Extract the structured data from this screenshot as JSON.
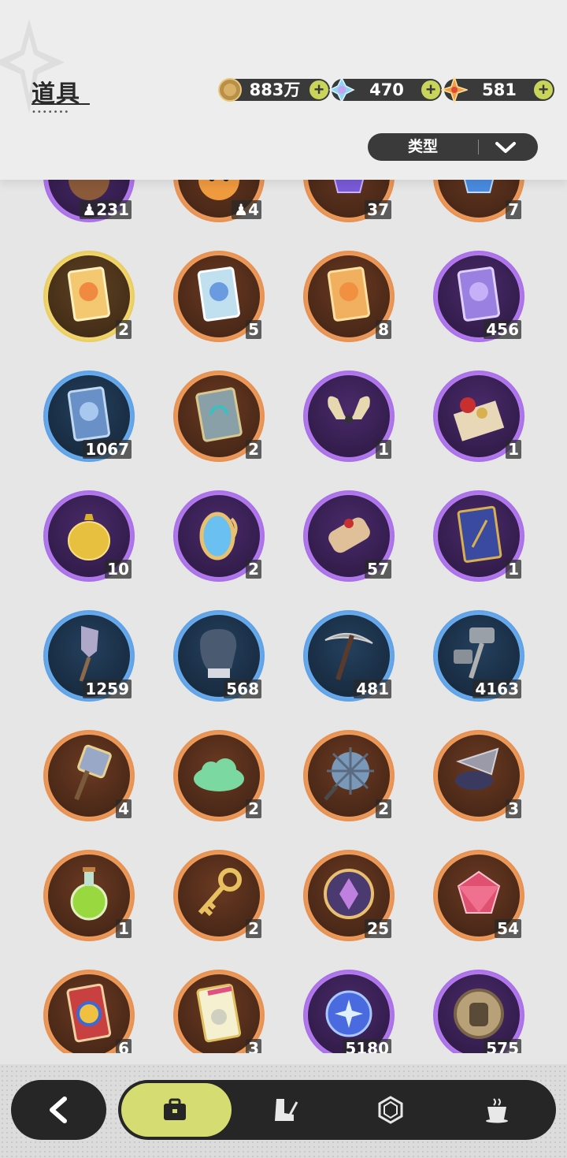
{
  "header": {
    "title": "道具",
    "title_dots": "•••••••",
    "currencies": [
      {
        "name": "gold-coin-icon",
        "value": "883万",
        "plus": "+"
      },
      {
        "name": "crystal-icon",
        "value": "470",
        "plus": "+"
      },
      {
        "name": "star-gem-icon",
        "value": "581",
        "plus": "+"
      }
    ],
    "filter": {
      "label": "类型"
    }
  },
  "items": [
    {
      "icon": "bear-face-icon",
      "rarity": "purple",
      "count": "231",
      "badge": "crowd"
    },
    {
      "icon": "fox-face-icon",
      "rarity": "orange",
      "count": "4",
      "badge": "crowd"
    },
    {
      "icon": "purple-crystal-icon",
      "rarity": "orange",
      "count": "37"
    },
    {
      "icon": "blue-crystal-icon",
      "rarity": "orange",
      "count": "7"
    },
    {
      "icon": "gold-card-icon",
      "rarity": "gold",
      "count": "2"
    },
    {
      "icon": "rainbow-card-icon",
      "rarity": "orange",
      "count": "5"
    },
    {
      "icon": "orange-card-icon",
      "rarity": "orange",
      "count": "8"
    },
    {
      "icon": "purple-card-icon",
      "rarity": "purple",
      "count": "456"
    },
    {
      "icon": "blue-card-icon",
      "rarity": "blue",
      "count": "1067"
    },
    {
      "icon": "book-icon",
      "rarity": "orange",
      "count": "2"
    },
    {
      "icon": "horn-crown-icon",
      "rarity": "purple",
      "count": "1"
    },
    {
      "icon": "gift-box-icon",
      "rarity": "purple",
      "count": "1"
    },
    {
      "icon": "gold-pouch-icon",
      "rarity": "purple",
      "count": "10"
    },
    {
      "icon": "mirror-icon",
      "rarity": "purple",
      "count": "2"
    },
    {
      "icon": "scroll-icon",
      "rarity": "purple",
      "count": "57"
    },
    {
      "icon": "blue-tome-icon",
      "rarity": "purple",
      "count": "1"
    },
    {
      "icon": "shovel-icon",
      "rarity": "blue",
      "count": "1259"
    },
    {
      "icon": "glove-icon",
      "rarity": "blue",
      "count": "568"
    },
    {
      "icon": "pickaxe-icon",
      "rarity": "blue",
      "count": "481"
    },
    {
      "icon": "hammers-icon",
      "rarity": "blue",
      "count": "4163"
    },
    {
      "icon": "mallet-icon",
      "rarity": "orange",
      "count": "4"
    },
    {
      "icon": "green-cloud-icon",
      "rarity": "orange",
      "count": "2"
    },
    {
      "icon": "spiked-ball-icon",
      "rarity": "orange",
      "count": "2"
    },
    {
      "icon": "drill-icon",
      "rarity": "orange",
      "count": "3"
    },
    {
      "icon": "potion-icon",
      "rarity": "orange",
      "count": "1"
    },
    {
      "icon": "key-icon",
      "rarity": "orange",
      "count": "2"
    },
    {
      "icon": "emblem-icon",
      "rarity": "orange",
      "count": "25"
    },
    {
      "icon": "red-gem-icon",
      "rarity": "orange",
      "count": "54"
    },
    {
      "icon": "wheel-ticket-icon",
      "rarity": "orange",
      "count": "6"
    },
    {
      "icon": "rainbow-ticket-icon",
      "rarity": "orange",
      "count": "3"
    },
    {
      "icon": "blue-orb-icon",
      "rarity": "purple",
      "count": "5180"
    },
    {
      "icon": "fist-coin-icon",
      "rarity": "purple",
      "count": "575"
    }
  ],
  "nav": {
    "back": "chevron-left-icon",
    "tabs": [
      {
        "icon": "briefcase-icon",
        "active": true
      },
      {
        "icon": "boot-sword-icon",
        "active": false
      },
      {
        "icon": "hexagon-gem-icon",
        "active": false
      },
      {
        "icon": "coffee-cup-icon",
        "active": false
      }
    ]
  }
}
